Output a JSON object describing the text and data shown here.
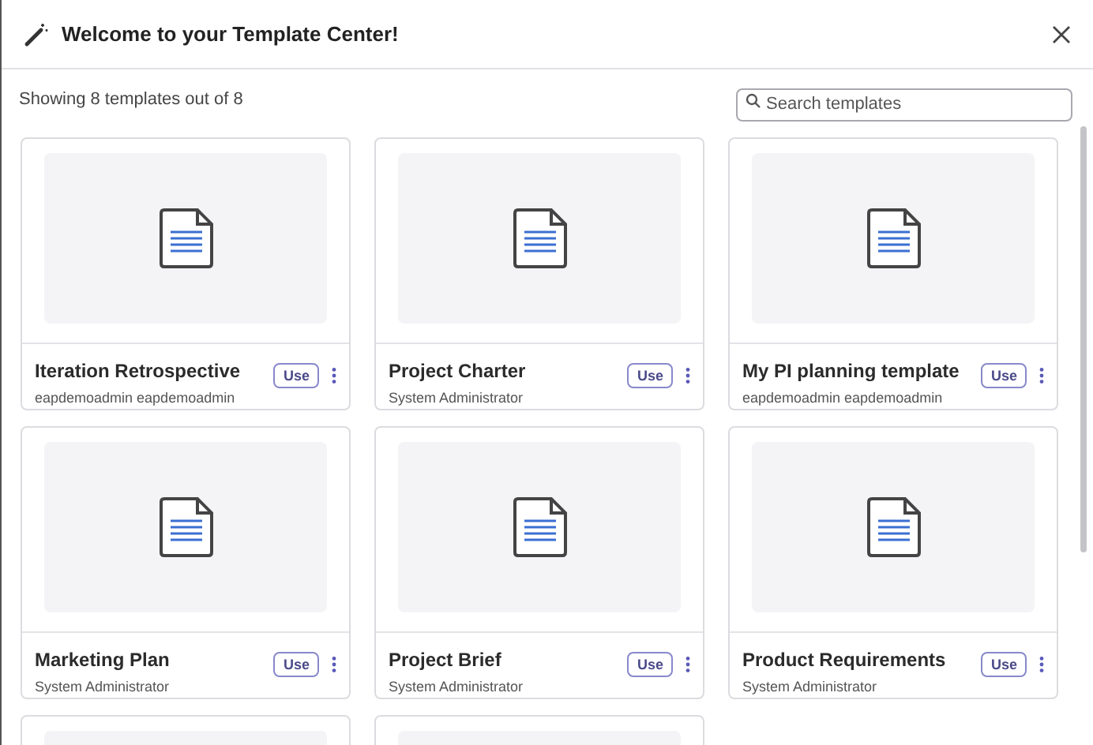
{
  "dialog": {
    "title": "Welcome to your Template Center!"
  },
  "summary": "Showing 8 templates out of 8",
  "search": {
    "placeholder": "Search templates"
  },
  "templates": [
    {
      "name": "Iteration Retrospective",
      "author": "eapdemoadmin eapdemoadmin",
      "action": "Use"
    },
    {
      "name": "Project Charter",
      "author": "System Administrator",
      "action": "Use"
    },
    {
      "name": "My PI planning template",
      "author": "eapdemoadmin eapdemoadmin",
      "action": "Use"
    },
    {
      "name": "Marketing Plan",
      "author": "System Administrator",
      "action": "Use"
    },
    {
      "name": "Project Brief",
      "author": "System Administrator",
      "action": "Use"
    },
    {
      "name": "Product Requirements",
      "author": "System Administrator",
      "action": "Use"
    }
  ]
}
